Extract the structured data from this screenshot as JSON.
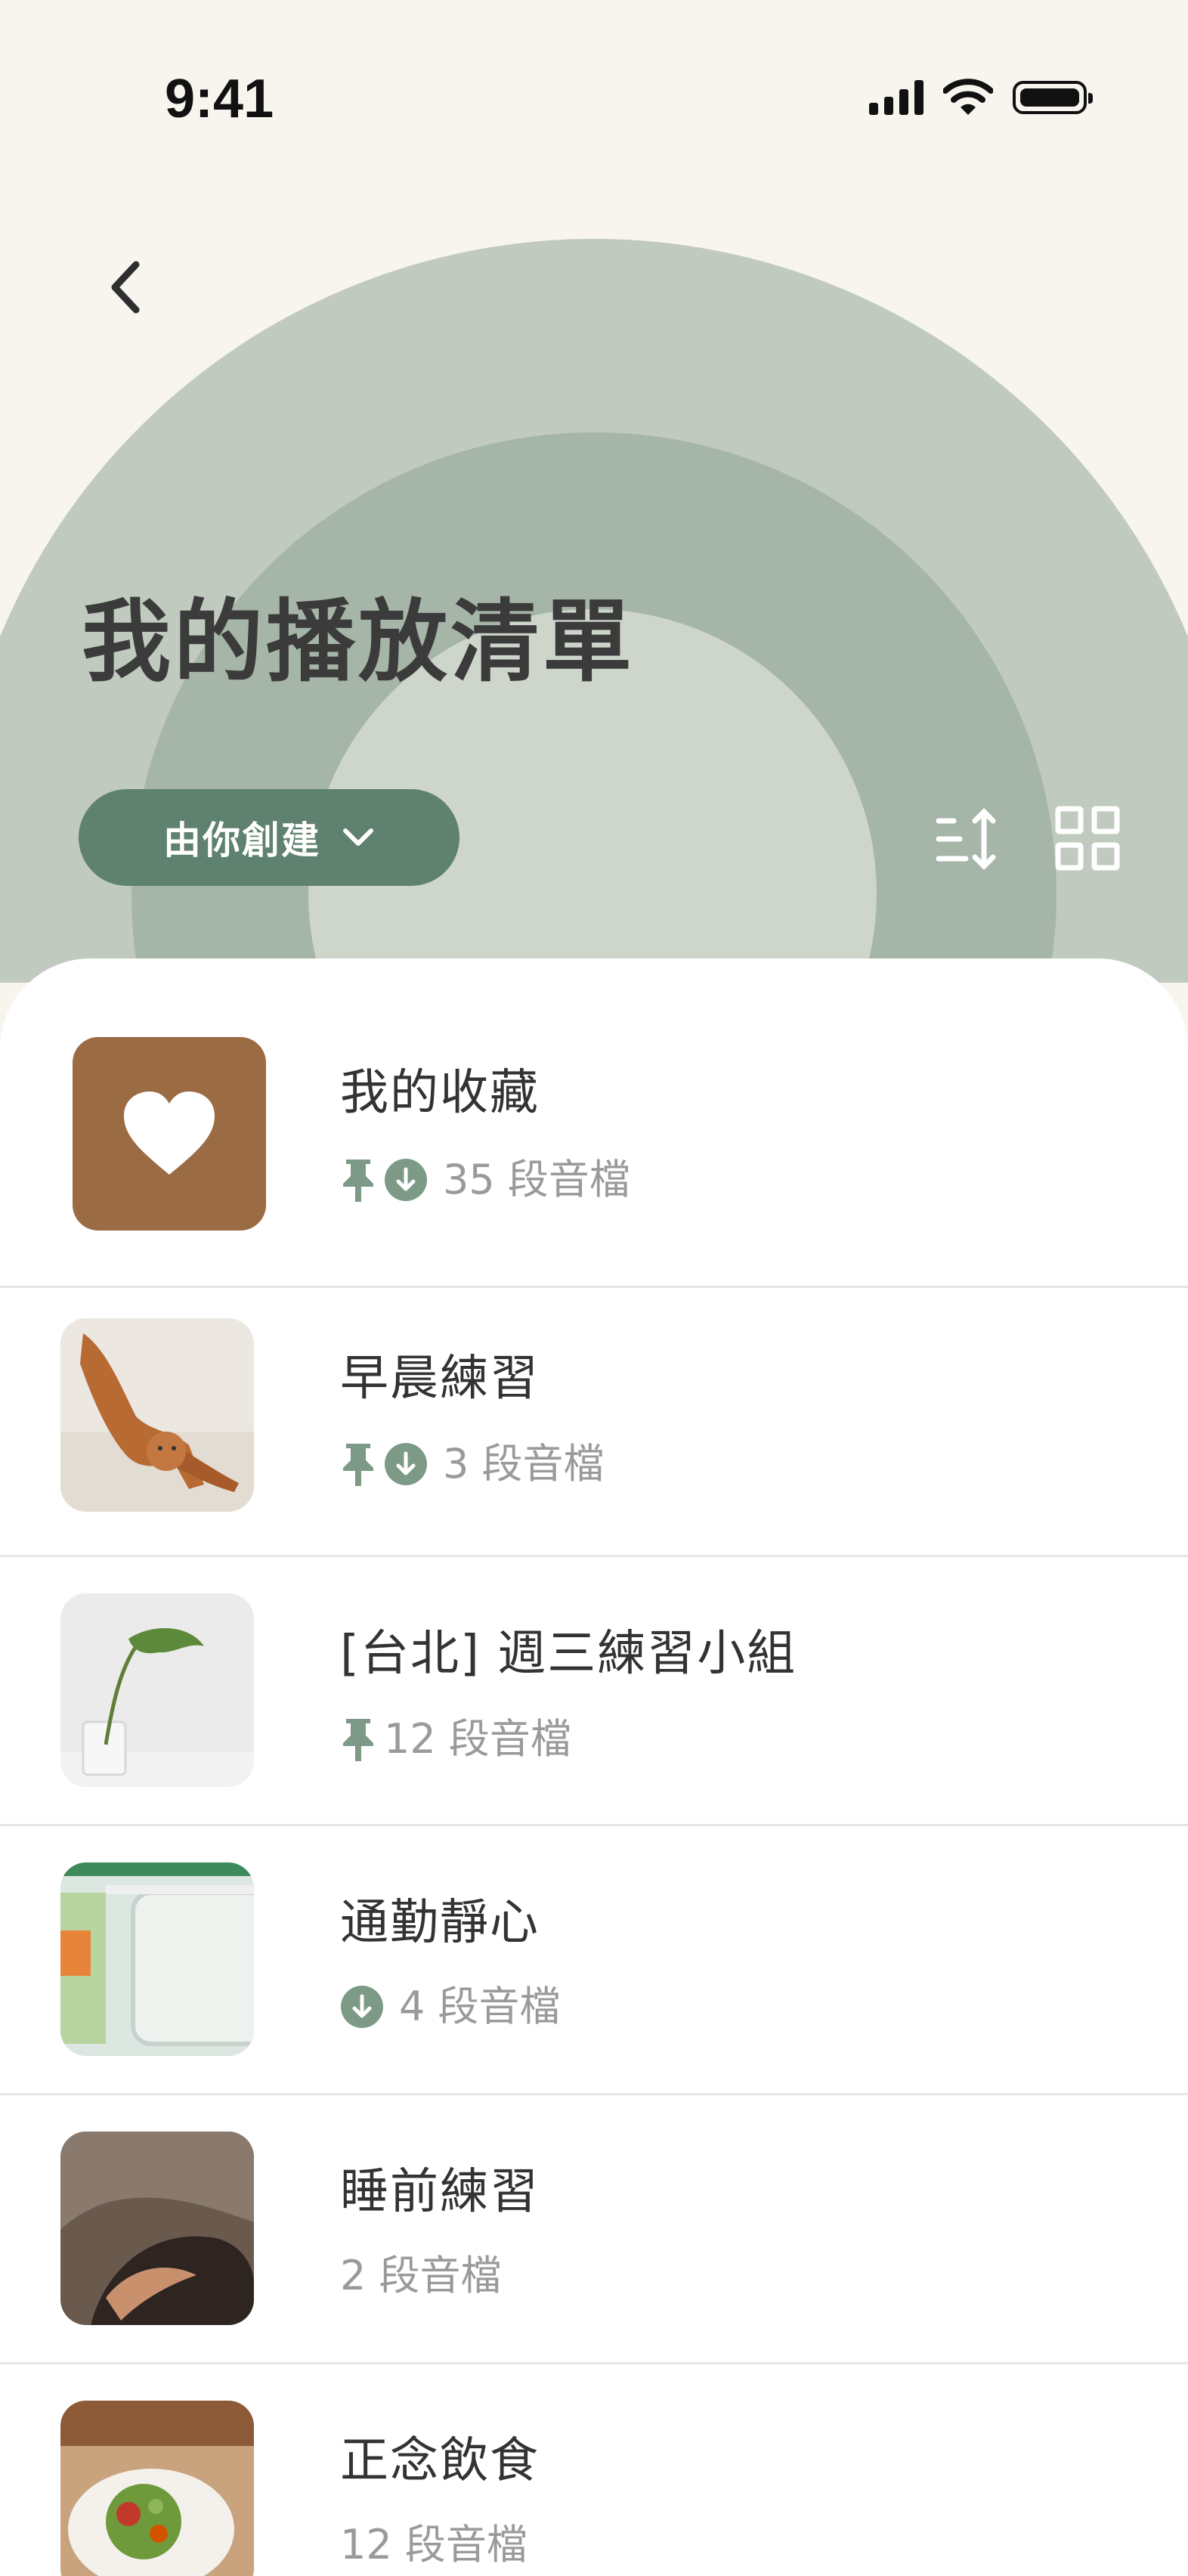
{
  "status_bar": {
    "time": "9:41"
  },
  "header": {
    "title": "我的播放清單"
  },
  "filter": {
    "label": "由你創建"
  },
  "colors": {
    "accent": "#5F816F",
    "favorites_tile": "#9B6B44",
    "icon_green": "#7C9A86"
  },
  "playlists": [
    {
      "title": "我的收藏",
      "count": "35 段音檔",
      "pinned": true,
      "downloaded": true,
      "thumb": "heart-tile"
    },
    {
      "title": "早晨練習",
      "count": "3 段音檔",
      "pinned": true,
      "downloaded": true,
      "thumb": "cat-photo"
    },
    {
      "title": "[台北] 週三練習小組",
      "count": "12 段音檔",
      "pinned": true,
      "downloaded": false,
      "thumb": "plant-photo"
    },
    {
      "title": "通勤靜心",
      "count": "4 段音檔",
      "pinned": false,
      "downloaded": true,
      "thumb": "tablet-photo"
    },
    {
      "title": "睡前練習",
      "count": "2 段音檔",
      "pinned": false,
      "downloaded": false,
      "thumb": "sleeping-photo"
    },
    {
      "title": "正念飲食",
      "count": "12 段音檔",
      "pinned": false,
      "downloaded": false,
      "thumb": "salad-photo"
    }
  ]
}
